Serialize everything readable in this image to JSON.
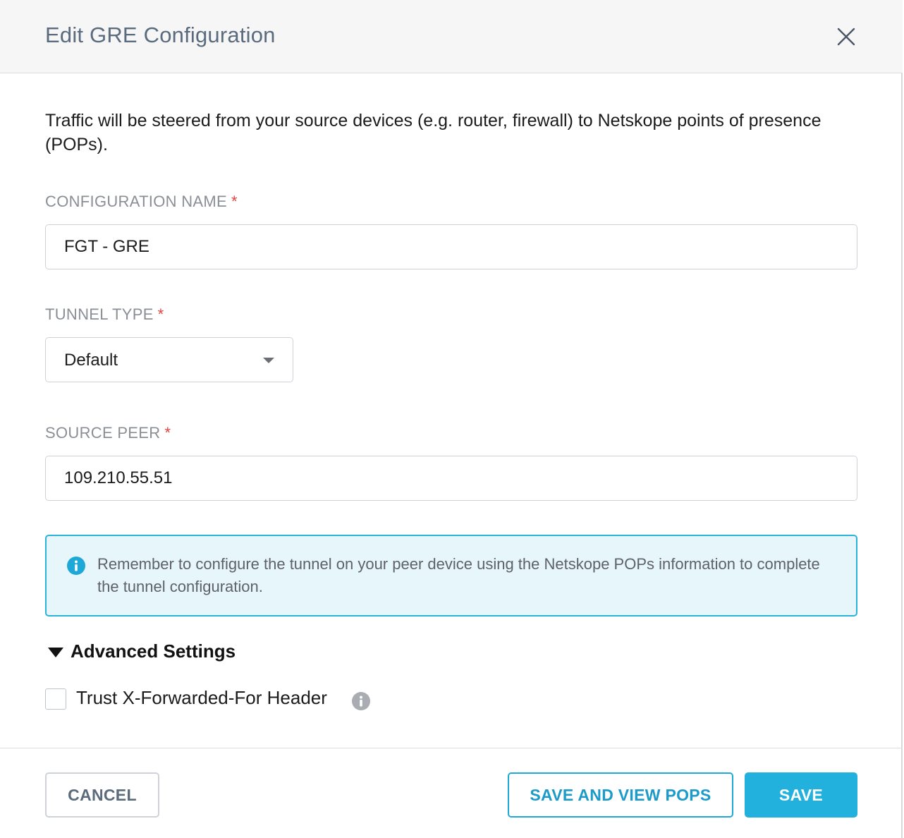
{
  "dialog": {
    "title": "Edit GRE Configuration",
    "close_icon": "close-icon"
  },
  "intro_text": "Traffic will be steered from your source devices (e.g. router, firewall) to Netskope points of presence (POPs).",
  "fields": {
    "configuration_name": {
      "label": "CONFIGURATION NAME",
      "required_mark": "*",
      "value": "FGT - GRE"
    },
    "tunnel_type": {
      "label": "TUNNEL TYPE",
      "required_mark": "*",
      "selected": "Default"
    },
    "source_peer": {
      "label": "SOURCE PEER",
      "required_mark": "*",
      "value": "109.210.55.51"
    }
  },
  "info_banner": {
    "icon": "info-icon",
    "text": "Remember to configure the tunnel on your peer device using the Netskope POPs information to complete the tunnel configuration."
  },
  "advanced": {
    "label": "Advanced Settings",
    "expanded": true,
    "trust_xff": {
      "label": "Trust X-Forwarded-For Header",
      "checked": false,
      "help_icon": "info-icon"
    }
  },
  "footer": {
    "cancel_label": "CANCEL",
    "save_view_label": "SAVE AND VIEW POPS",
    "save_label": "SAVE"
  },
  "colors": {
    "accent": "#22b0dc",
    "info_bg": "#e6f6fb",
    "required": "#e0443f"
  }
}
